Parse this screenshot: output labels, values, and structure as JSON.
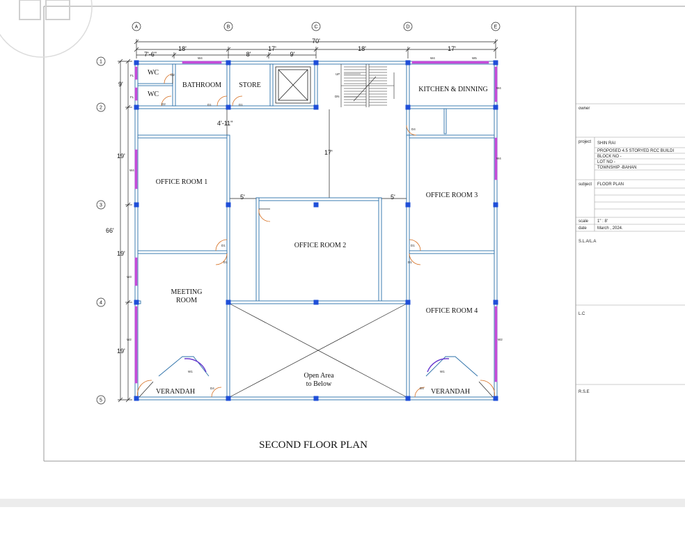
{
  "drawing": {
    "title": "SECOND  FLOOR  PLAN",
    "grid_cols": [
      "A",
      "B",
      "C",
      "D",
      "E"
    ],
    "grid_rows": [
      "1",
      "2",
      "3",
      "4",
      "5"
    ],
    "dims_top": {
      "overall": "70'",
      "seg1": "18'",
      "seg2": "17'",
      "seg3": "18'",
      "seg4": "17'",
      "sub1": "7'-6\"",
      "sub2": "8'",
      "sub3": "9'"
    },
    "dims_left": {
      "overall": "66'",
      "seg1": "9'",
      "seg2": "19'",
      "seg3": "19'",
      "seg4": "19'"
    },
    "dims_inner": {
      "corridor": "4'-11\"",
      "stair_gap": "17'",
      "left_gap": "5'",
      "right_gap": "5'"
    },
    "rooms": {
      "wc1": "WC",
      "wc2": "WC",
      "bathroom": "BATHROOM",
      "store": "STORE",
      "kitchen": "KITCHEN & DINNING",
      "office1": "OFFICE ROOM 1",
      "office2": "OFFICE ROOM 2",
      "office3": "OFFICE ROOM 3",
      "office4": "OFFICE ROOM 4",
      "meeting1": "MEETING",
      "meeting2": "ROOM",
      "open1": "Open Area",
      "open2": "to Below",
      "verandah_left": "VERANDAH",
      "verandah_right": "VERANDAH"
    },
    "stair": {
      "up": "UP",
      "dn": "DN"
    },
    "tags": {
      "w4a": "W4",
      "w4b": "W4",
      "w5": "W5",
      "w4c": "W4",
      "w4d": "W4",
      "w4e": "W4",
      "fl1": "FL",
      "fl2": "FL",
      "w3": "W3",
      "w2a": "W2",
      "w2b": "W2",
      "w1a": "W1",
      "w1b": "W1",
      "d2a": "D2",
      "d2b": "D2",
      "d1a": "D1",
      "d1b": "D1",
      "d1c": "D1",
      "d1d": "D1",
      "d1e": "D1",
      "d1f": "D1",
      "d4a": "D4",
      "d4b": "D4",
      "d4c": "D4"
    }
  },
  "title_block": {
    "owner_label": "owner",
    "project_label": "project",
    "project_lines": [
      "SHIN RAI",
      "PROPOSED 4.5 STORYED RCC BUILDI",
      "BLOCK NO  -",
      "LOT NO     -",
      "TOWNSHIP -BAHAN"
    ],
    "subject_label": "subject",
    "subject_value": "FLOOR PLAN",
    "scale_label": "scale",
    "scale_value": "1\" : 8'",
    "date_label": "date",
    "date_value": "March , 2024.",
    "sla_label": "S.L.A/L.A",
    "lc_label": "L.C",
    "rse_label": "R.S.E"
  },
  "colors": {
    "wall": "#2a6fa8",
    "wall_fill": "#ffffff",
    "column": "#1f4fd8",
    "window": "#c64bd8",
    "door": "#d46a1a",
    "line": "#222222"
  }
}
